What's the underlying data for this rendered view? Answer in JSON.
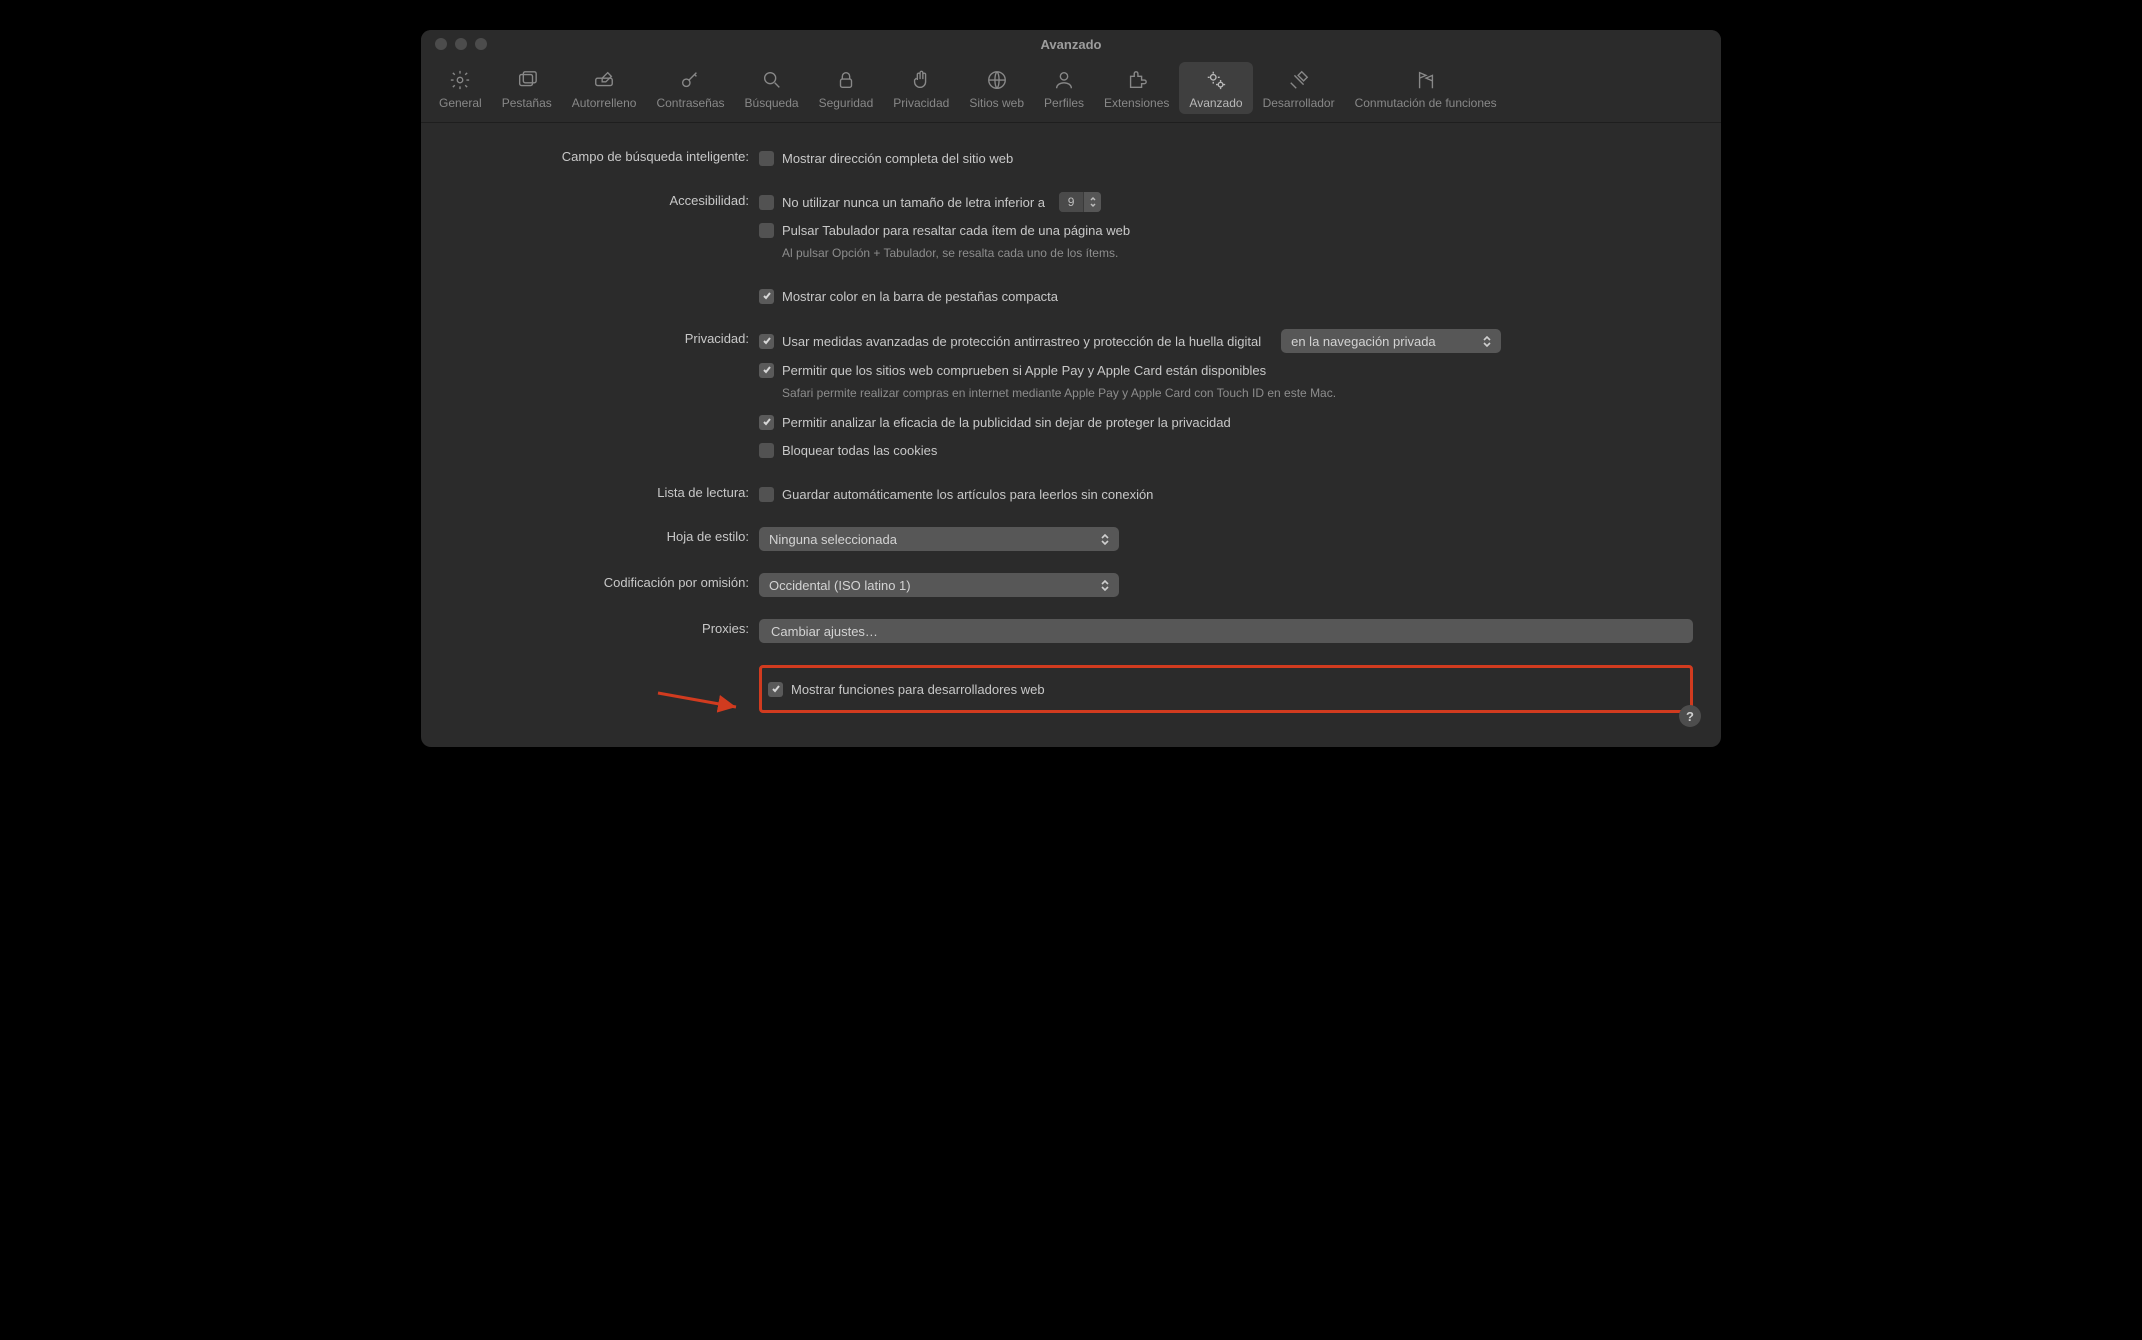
{
  "window": {
    "title": "Avanzado"
  },
  "tabs": [
    {
      "label": "General"
    },
    {
      "label": "Pestañas"
    },
    {
      "label": "Autorrelleno"
    },
    {
      "label": "Contraseñas"
    },
    {
      "label": "Búsqueda"
    },
    {
      "label": "Seguridad"
    },
    {
      "label": "Privacidad"
    },
    {
      "label": "Sitios web"
    },
    {
      "label": "Perfiles"
    },
    {
      "label": "Extensiones"
    },
    {
      "label": "Avanzado"
    },
    {
      "label": "Desarrollador"
    },
    {
      "label": "Conmutación de funciones"
    }
  ],
  "sections": {
    "smartSearch": {
      "label": "Campo de búsqueda inteligente:",
      "showFullAddress": {
        "text": "Mostrar dirección completa del sitio web",
        "checked": false
      }
    },
    "accessibility": {
      "label": "Accesibilidad:",
      "minFont": {
        "text": "No utilizar nunca un tamaño de letra inferior a",
        "checked": false,
        "value": "9"
      },
      "tabHighlight": {
        "text": "Pulsar Tabulador para resaltar cada ítem de una página web",
        "checked": false
      },
      "tabHint": "Al pulsar Opción + Tabulador, se resalta cada uno de los ítems.",
      "compactColor": {
        "text": "Mostrar color en la barra de pestañas compacta",
        "checked": true
      }
    },
    "privacy": {
      "label": "Privacidad:",
      "advancedTracking": {
        "text": "Usar medidas avanzadas de protección antirrastreo y protección de la huella digital",
        "checked": true
      },
      "trackingScope": "en la navegación privada",
      "applePay": {
        "text": "Permitir que los sitios web comprueben si Apple Pay y Apple Card están disponibles",
        "checked": true
      },
      "applePayHint": "Safari permite realizar compras en internet mediante Apple Pay y Apple Card con Touch ID en este Mac.",
      "adEffectiveness": {
        "text": "Permitir analizar la eficacia de la publicidad sin dejar de proteger la privacidad",
        "checked": true
      },
      "blockCookies": {
        "text": "Bloquear todas las cookies",
        "checked": false
      }
    },
    "readingList": {
      "label": "Lista de lectura:",
      "saveOffline": {
        "text": "Guardar automáticamente los artículos para leerlos sin conexión",
        "checked": false
      }
    },
    "stylesheet": {
      "label": "Hoja de estilo:",
      "value": "Ninguna seleccionada"
    },
    "encoding": {
      "label": "Codificación por omisión:",
      "value": "Occidental (ISO latino 1)"
    },
    "proxies": {
      "label": "Proxies:",
      "button": "Cambiar ajustes…"
    },
    "developer": {
      "text": "Mostrar funciones para desarrolladores web",
      "checked": true
    }
  },
  "help": "?"
}
